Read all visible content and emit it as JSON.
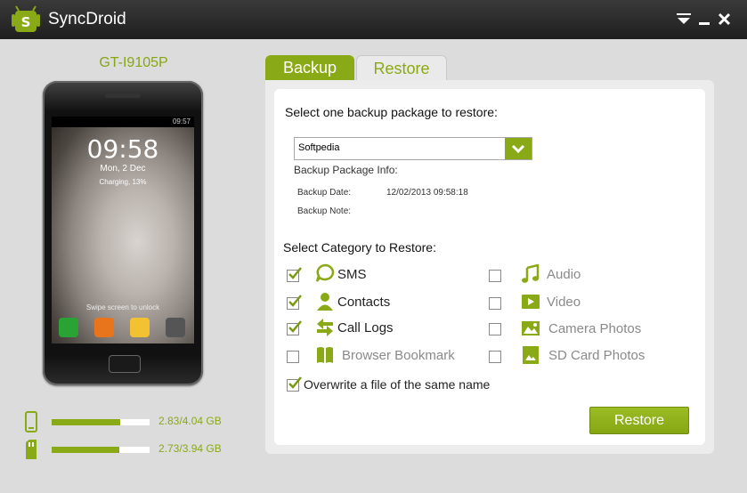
{
  "window": {
    "title": "SyncDroid"
  },
  "device": {
    "name": "GT-I9105P",
    "screen": {
      "time": "09:58",
      "date": "Mon, 2 Dec",
      "charging": "Charging, 13%",
      "hint": "Swipe screen to unlock",
      "status_clock": "09:57"
    },
    "storage": [
      {
        "icon": "phone-storage-icon",
        "used": 2.83,
        "total": 4.04,
        "label": "2.83/4.04 GB"
      },
      {
        "icon": "sd-card-icon",
        "used": 2.73,
        "total": 3.94,
        "label": "2.73/3.94 GB"
      }
    ]
  },
  "tabs": [
    {
      "label": "Backup",
      "active": false
    },
    {
      "label": "Restore",
      "active": true
    }
  ],
  "restore": {
    "select_heading": "Select one backup package to restore:",
    "package_value": "Softpedia",
    "info_heading": "Backup Package Info:",
    "backup_date_label": "Backup Date:",
    "backup_date_value": "12/02/2013 09:58:18",
    "backup_note_label": "Backup Note:",
    "backup_note_value": "",
    "category_heading": "Select Category to Restore:",
    "categories_left": [
      {
        "label": "SMS",
        "checked": true,
        "enabled": true,
        "icon": "sms-icon"
      },
      {
        "label": "Contacts",
        "checked": true,
        "enabled": true,
        "icon": "contacts-icon"
      },
      {
        "label": "Call Logs",
        "checked": true,
        "enabled": true,
        "icon": "call-logs-icon"
      },
      {
        "label": "Browser Bookmark",
        "checked": false,
        "enabled": false,
        "icon": "bookmark-icon"
      }
    ],
    "categories_right": [
      {
        "label": "Audio",
        "checked": false,
        "enabled": false,
        "icon": "audio-icon"
      },
      {
        "label": "Video",
        "checked": false,
        "enabled": false,
        "icon": "video-icon"
      },
      {
        "label": "Camera Photos",
        "checked": false,
        "enabled": false,
        "icon": "camera-photos-icon"
      },
      {
        "label": "SD Card Photos",
        "checked": false,
        "enabled": false,
        "icon": "sd-card-photos-icon"
      }
    ],
    "overwrite_label": "Overwrite a file of the same name",
    "overwrite_checked": true,
    "restore_button": "Restore"
  },
  "colors": {
    "accent": "#8aa916",
    "titlebar": "#2a2a2a",
    "disabled_text": "#8a8a8a"
  }
}
